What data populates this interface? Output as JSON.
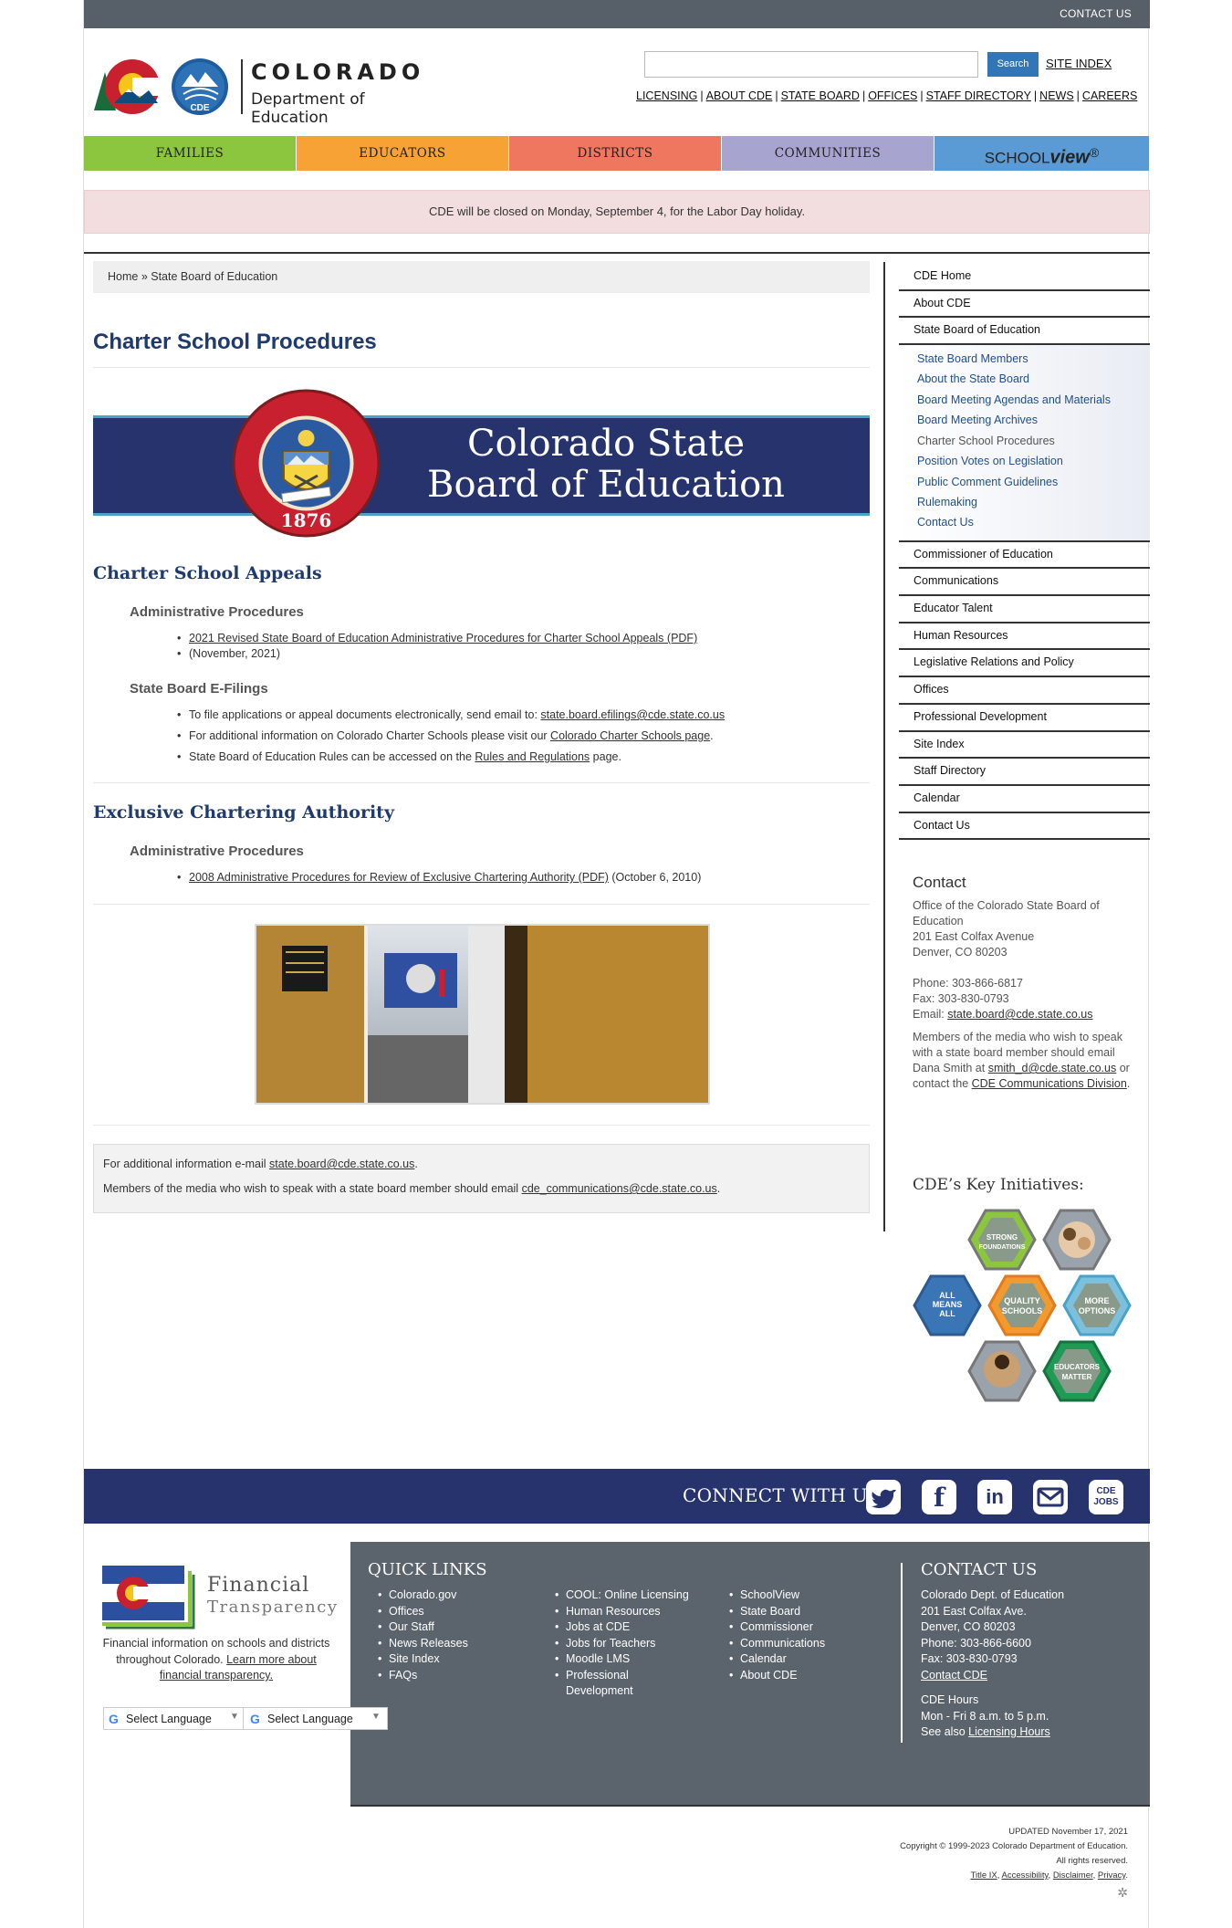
{
  "topbar": {
    "contact": "CONTACT US"
  },
  "header": {
    "wordmark_line1": "COLORADO",
    "wordmark_line2": "Department of Education",
    "cde_badge": "CDE",
    "search_button": "Search",
    "site_index": "SITE INDEX",
    "util_links": [
      "LICENSING",
      "ABOUT CDE",
      "STATE BOARD",
      "OFFICES",
      "STAFF DIRECTORY",
      "NEWS",
      "CAREERS"
    ]
  },
  "mainnav": {
    "families": "FAMILIES",
    "educators": "EDUCATORS",
    "districts": "DISTRICTS",
    "communities": "COMMUNITIES",
    "schoolview_a": "SCHOOL",
    "schoolview_b": "view",
    "schoolview_reg": "®"
  },
  "alert": "CDE will be closed on Monday, September 4, for the Labor Day holiday.",
  "breadcrumb": {
    "home": "Home",
    "sep": " » ",
    "current": "State Board of Education"
  },
  "page_title": "Charter School Procedures",
  "banner": {
    "title_line1": "Colorado State",
    "title_line2": "Board of Education",
    "seal_year": "1876"
  },
  "appeals": {
    "title": "Charter School Appeals",
    "admin_title": "Administrative Procedures",
    "admin_link": "2021 Revised State Board of Education Administrative Procedures for Charter School Appeals (PDF)",
    "admin_date": "(November, 2021)",
    "efilings_title": "State Board E-Filings",
    "efile_1_text": "To file applications or appeal documents electronically, send email to: ",
    "efile_1_link": "state.board.efilings@cde.state.co.us",
    "efile_2_text": "For additional information on Colorado Charter Schools please visit our ",
    "efile_2_link": "Colorado Charter Schools page",
    "efile_2_end": ".",
    "efile_3_text": "State Board of Education Rules can be accessed on the ",
    "efile_3_link": "Rules and Regulations",
    "efile_3_end": " page."
  },
  "exclusive": {
    "title": "Exclusive Chartering Authority",
    "admin_title": "Administrative Procedures",
    "link": "2008 Administrative Procedures for Review of Exclusive Chartering Authority (PDF)",
    "date": " (October 6, 2010)"
  },
  "infobox": {
    "line1_text": "For additional information e-mail ",
    "line1_link": "state.board@cde.state.co.us",
    "line1_end": ".",
    "line2_text": "Members of the media who wish to speak with a state board member should email ",
    "line2_link": "cde_communications@cde.state.co.us",
    "line2_end": "."
  },
  "sidenav": {
    "top": [
      "CDE Home",
      "About CDE",
      "State Board of Education"
    ],
    "sub": [
      "State Board Members",
      "About the State Board",
      "Board Meeting Agendas and Materials",
      "Board Meeting Archives",
      "Charter School Procedures",
      "Position Votes on Legislation",
      "Public Comment Guidelines",
      "Rulemaking",
      "Contact Us"
    ],
    "bottom": [
      "Commissioner of Education",
      "Communications",
      "Educator Talent",
      "Human Resources",
      "Legislative Relations and Policy",
      "Offices",
      "Professional Development",
      "Site Index",
      "Staff Directory",
      "Calendar",
      "Contact Us"
    ]
  },
  "contact_side": {
    "title": "Contact",
    "office": "Office of the Colorado State Board of Education",
    "street": "201 East Colfax Avenue",
    "city": "Denver, CO 80203",
    "phone": "Phone: 303-866-6817",
    "fax": "Fax: 303-830-0793",
    "email_label": "Email: ",
    "email": "state.board@cde.state.co.us",
    "media_1": "Members of the media who wish to speak with a state board member should email Dana Smith at ",
    "media_link": "smith_d@cde.state.co.us",
    "media_2": " or contact the ",
    "media_link2": "CDE Communications Division",
    "media_end": "."
  },
  "key_initiatives": {
    "title": "CDE’s Key Initiatives:",
    "hex_strong_1": "STRONG",
    "hex_strong_2": "FOUNDATIONS",
    "hex_all_1": "ALL",
    "hex_all_2": "MEANS",
    "hex_all_3": "ALL",
    "hex_quality_1": "QUALITY",
    "hex_quality_2": "SCHOOLS",
    "hex_more_1": "MORE",
    "hex_more_2": "OPTIONS",
    "hex_edu_1": "EDUCATORS",
    "hex_edu_2": "MATTER"
  },
  "connect": {
    "title": "CONNECT WITH US",
    "twitter": "t",
    "facebook": "f",
    "linkedin": "in",
    "jobs_1": "CDE",
    "jobs_2": "JOBS"
  },
  "footer": {
    "ft_line1": "Financial",
    "ft_line2": "Transparency",
    "ft_desc": "Financial information on schools and districts throughout Colorado. ",
    "ft_link": "Learn more about financial transparency.",
    "lang_g": "G",
    "lang_label": "Select Language",
    "lang_arrow": "▼",
    "quick_links_title": "QUICK LINKS",
    "col1": [
      "Colorado.gov",
      "Offices",
      "Our Staff",
      "News Releases",
      "Site Index",
      "FAQs"
    ],
    "col2": [
      "COOL: Online Licensing",
      "Human Resources",
      "Jobs at CDE",
      "Jobs for Teachers",
      "Moodle LMS",
      "Professional Development"
    ],
    "col3": [
      "SchoolView",
      "State Board",
      "Commissioner",
      "Communications",
      "Calendar",
      "About CDE"
    ],
    "contact_title": "CONTACT US",
    "contact": [
      "Colorado Dept. of Education",
      "201 East Colfax Ave.",
      "Denver, CO 80203",
      "Phone: 303-866-6600",
      "Fax: 303-830-0793"
    ],
    "contact_link": "Contact CDE",
    "hours_title": "CDE Hours",
    "hours": "Mon - Fri 8 a.m. to 5 p.m.",
    "hours_see": "See also ",
    "hours_link": "Licensing Hours"
  },
  "legal": {
    "updated": "UPDATED November 17, 2021",
    "copyright": "Copyright © 1999-2023 Colorado Department of Education.",
    "rights": "All rights reserved.",
    "links": [
      "Title IX",
      "Accessibility",
      "Disclaimer",
      "Privacy"
    ]
  },
  "colors": {
    "navy": "#27336d",
    "footer_gray": "#5b646d",
    "families": "#8cc63f",
    "educators": "#f7a234",
    "districts": "#ef7760",
    "communities": "#a7a5d0",
    "schoolview": "#5a9bd5"
  }
}
